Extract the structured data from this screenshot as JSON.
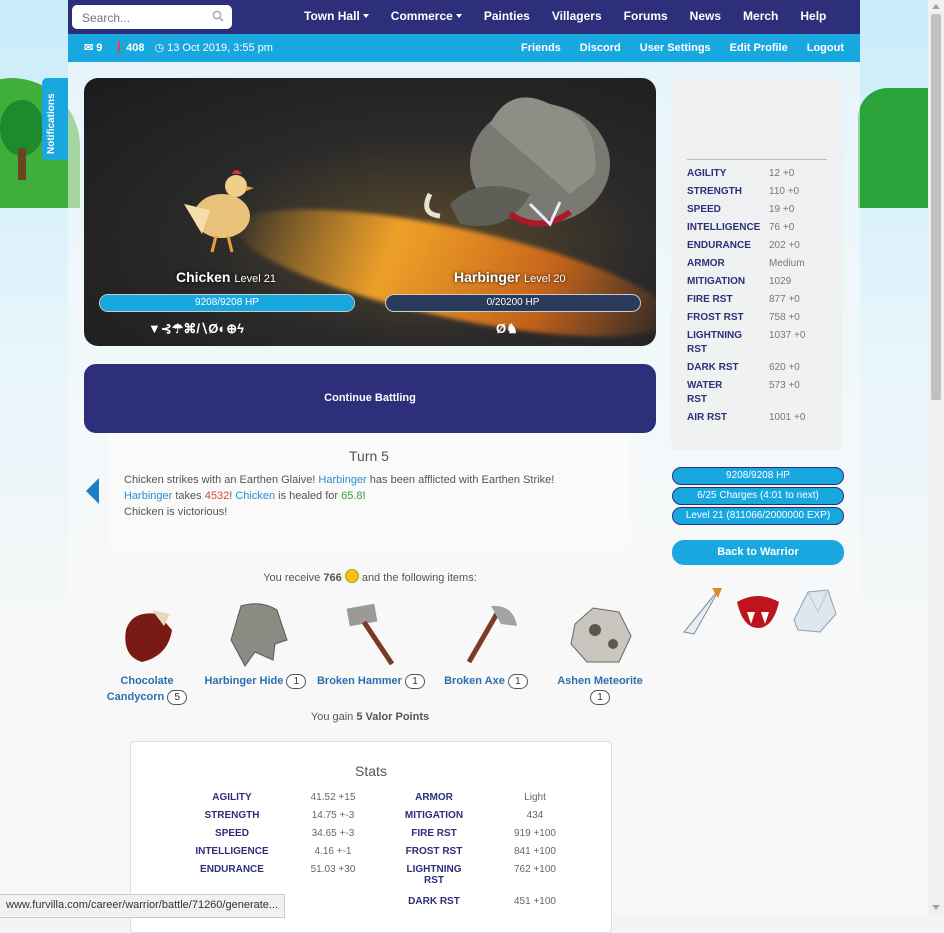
{
  "search": {
    "placeholder": "Search..."
  },
  "topnav": [
    {
      "label": "Town Hall",
      "dropdown": true
    },
    {
      "label": "Commerce",
      "dropdown": true
    },
    {
      "label": "Painties",
      "dropdown": false
    },
    {
      "label": "Villagers",
      "dropdown": false
    },
    {
      "label": "Forums",
      "dropdown": false
    },
    {
      "label": "News",
      "dropdown": false
    },
    {
      "label": "Merch",
      "dropdown": false
    },
    {
      "label": "Help",
      "dropdown": false
    }
  ],
  "subnav": {
    "messages": "9",
    "alerts": "408",
    "datetime": "13 Oct 2019, 3:55 pm",
    "links": [
      "Friends",
      "Discord",
      "User Settings",
      "Edit Profile",
      "Logout"
    ]
  },
  "notifications_tab": "Notifications",
  "battle": {
    "player": {
      "name": "Chicken",
      "level": "Level 21",
      "hp": "9208/9208 HP",
      "hp_fraction": 1.0,
      "status_icons": "▼⊰☂⌘/∖Ø◐⊕ϟ"
    },
    "enemy": {
      "name": "Harbinger",
      "level": "Level 20",
      "hp": "0/20200 HP",
      "hp_fraction": 0.0,
      "status_icons": "Ø♞"
    },
    "continue_label": "Continue Battling",
    "turn": "Turn 5",
    "log": {
      "l1a": "Chicken strikes with an Earthen Glaive! ",
      "l1b": "Harbinger",
      "l1c": " has been afflicted with Earthen Strike!",
      "l2a": "Harbinger",
      "l2b": " takes ",
      "l2c": "4532",
      "l2d": "! ",
      "l2e": "Chicken",
      "l2f": " is healed for ",
      "l2g": "65.8",
      "l2h": "!",
      "l3": "Chicken is victorious!"
    }
  },
  "rewards": {
    "prefix": "You receive ",
    "amount": "766",
    "suffix": " and the following items:",
    "items": [
      {
        "name_line1": "Chocolate",
        "name_line2": "Candycorn",
        "qty": "5"
      },
      {
        "name": "Harbinger Hide",
        "qty": "1"
      },
      {
        "name": "Broken Hammer",
        "qty": "1"
      },
      {
        "name": "Broken Axe",
        "qty": "1"
      },
      {
        "name": "Ashen Meteorite",
        "qty": "1"
      }
    ],
    "valor_prefix": "You gain ",
    "valor": "5 Valor Points"
  },
  "stats_card": {
    "title": "Stats",
    "rows": [
      {
        "l1": "AGILITY",
        "v1": "41.52 +15",
        "l2": "ARMOR",
        "v2": "Light"
      },
      {
        "l1": "STRENGTH",
        "v1": "14.75 +-3",
        "l2": "MITIGATION",
        "v2": "434"
      },
      {
        "l1": "SPEED",
        "v1": "34.65 +-3",
        "l2": "FIRE RST",
        "v2": "919 +100"
      },
      {
        "l1": "INTELLIGENCE",
        "v1": "4.16 +-1",
        "l2": "FROST RST",
        "v2": "841 +100"
      },
      {
        "l1": "ENDURANCE",
        "v1": "51.03 +30",
        "l2": "LIGHTNING",
        "l2b": "RST",
        "v2": "762 +100"
      },
      {
        "l1": "",
        "v1": "",
        "l2": "DARK RST",
        "v2": "451 +100"
      }
    ]
  },
  "side_stats": [
    {
      "label": "AGILITY",
      "value": "12 +0"
    },
    {
      "label": "STRENGTH",
      "value": "110 +0"
    },
    {
      "label": "SPEED",
      "value": "19 +0"
    },
    {
      "label": "INTELLIGENCE",
      "value": "76 +0"
    },
    {
      "label": "ENDURANCE",
      "value": "202 +0"
    },
    {
      "label": "ARMOR",
      "value": "Medium"
    },
    {
      "label": "MITIGATION",
      "value": "1029"
    },
    {
      "label": "FIRE RST",
      "value": "877 +0"
    },
    {
      "label": "FROST RST",
      "value": "758 +0"
    },
    {
      "label": "LIGHTNING",
      "label2": "RST",
      "value": "1037 +0"
    },
    {
      "label": "DARK RST",
      "value": "620 +0"
    },
    {
      "label": "WATER",
      "label2": "RST",
      "value": "573 +0"
    },
    {
      "label": "AIR RST",
      "value": "1001 +0"
    }
  ],
  "side_bars": {
    "hp": "9208/9208 HP",
    "charges": "6/25 Charges (4:01 to next)",
    "level": "Level 21 (811066/2000000 EXP)"
  },
  "back_button": "Back to Warrior",
  "status_url": "www.furvilla.com/career/warrior/battle/71260/generate...",
  "colors": {
    "navy": "#2d2f7a",
    "sky": "#19a7e0",
    "link": "#2a6fb0"
  }
}
